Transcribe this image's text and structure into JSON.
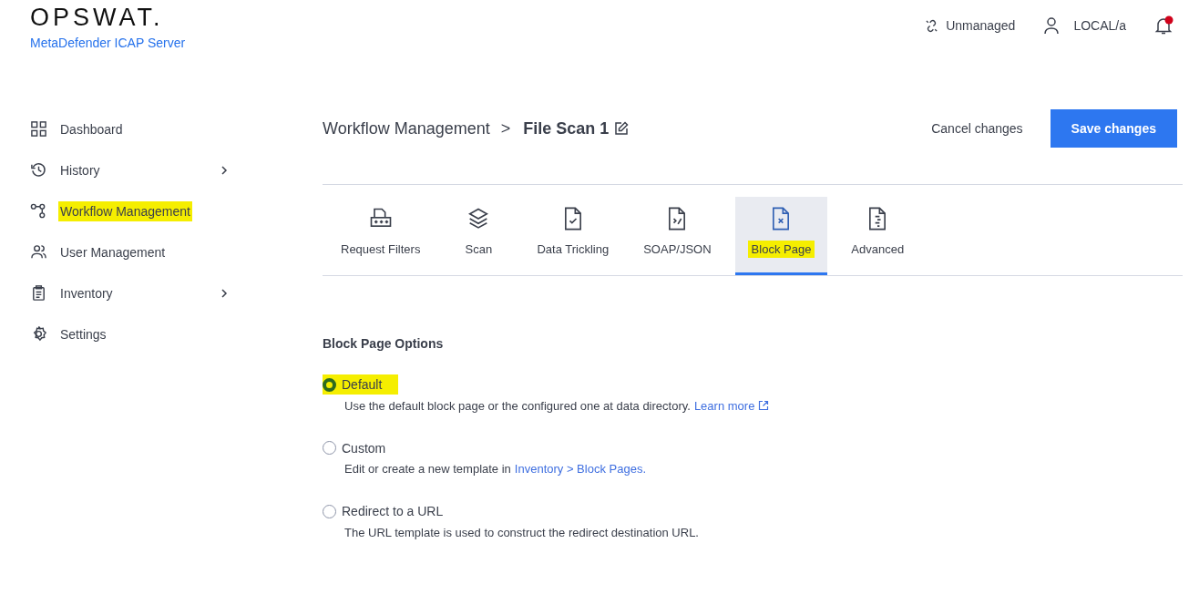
{
  "header": {
    "logo": "OPSWAT.",
    "product": "MetaDefender ICAP Server",
    "status": "Unmanaged",
    "user": "LOCAL/a",
    "notification_unread": true
  },
  "sidebar": {
    "items": [
      {
        "label": "Dashboard",
        "submenu": false,
        "highlighted": false
      },
      {
        "label": "History",
        "submenu": true,
        "highlighted": false
      },
      {
        "label": "Workflow Management",
        "submenu": false,
        "highlighted": true
      },
      {
        "label": "User Management",
        "submenu": false,
        "highlighted": false
      },
      {
        "label": "Inventory",
        "submenu": true,
        "highlighted": false
      },
      {
        "label": "Settings",
        "submenu": false,
        "highlighted": false
      }
    ]
  },
  "breadcrumb": {
    "parent": "Workflow Management",
    "separator": ">",
    "current": "File Scan 1"
  },
  "actions": {
    "cancel": "Cancel changes",
    "save": "Save changes"
  },
  "tabs": [
    {
      "label": "Request Filters",
      "selected": false,
      "highlighted": false
    },
    {
      "label": "Scan",
      "selected": false,
      "highlighted": false
    },
    {
      "label": "Data Trickling",
      "selected": false,
      "highlighted": false
    },
    {
      "label": "SOAP/JSON",
      "selected": false,
      "highlighted": false
    },
    {
      "label": "Block Page",
      "selected": true,
      "highlighted": true
    },
    {
      "label": "Advanced",
      "selected": false,
      "highlighted": false
    }
  ],
  "section": {
    "title": "Block Page Options",
    "options": [
      {
        "label": "Default",
        "selected": true,
        "highlighted": true,
        "description": "Use the default block page or the configured one at data directory.",
        "link": "Learn more",
        "external": true
      },
      {
        "label": "Custom",
        "selected": false,
        "highlighted": false,
        "description": "Edit or create a new template in",
        "link": "Inventory > Block Pages.",
        "external": false
      },
      {
        "label": "Redirect to a URL",
        "selected": false,
        "highlighted": false,
        "description": "The URL template is used to construct the redirect destination URL."
      }
    ]
  }
}
